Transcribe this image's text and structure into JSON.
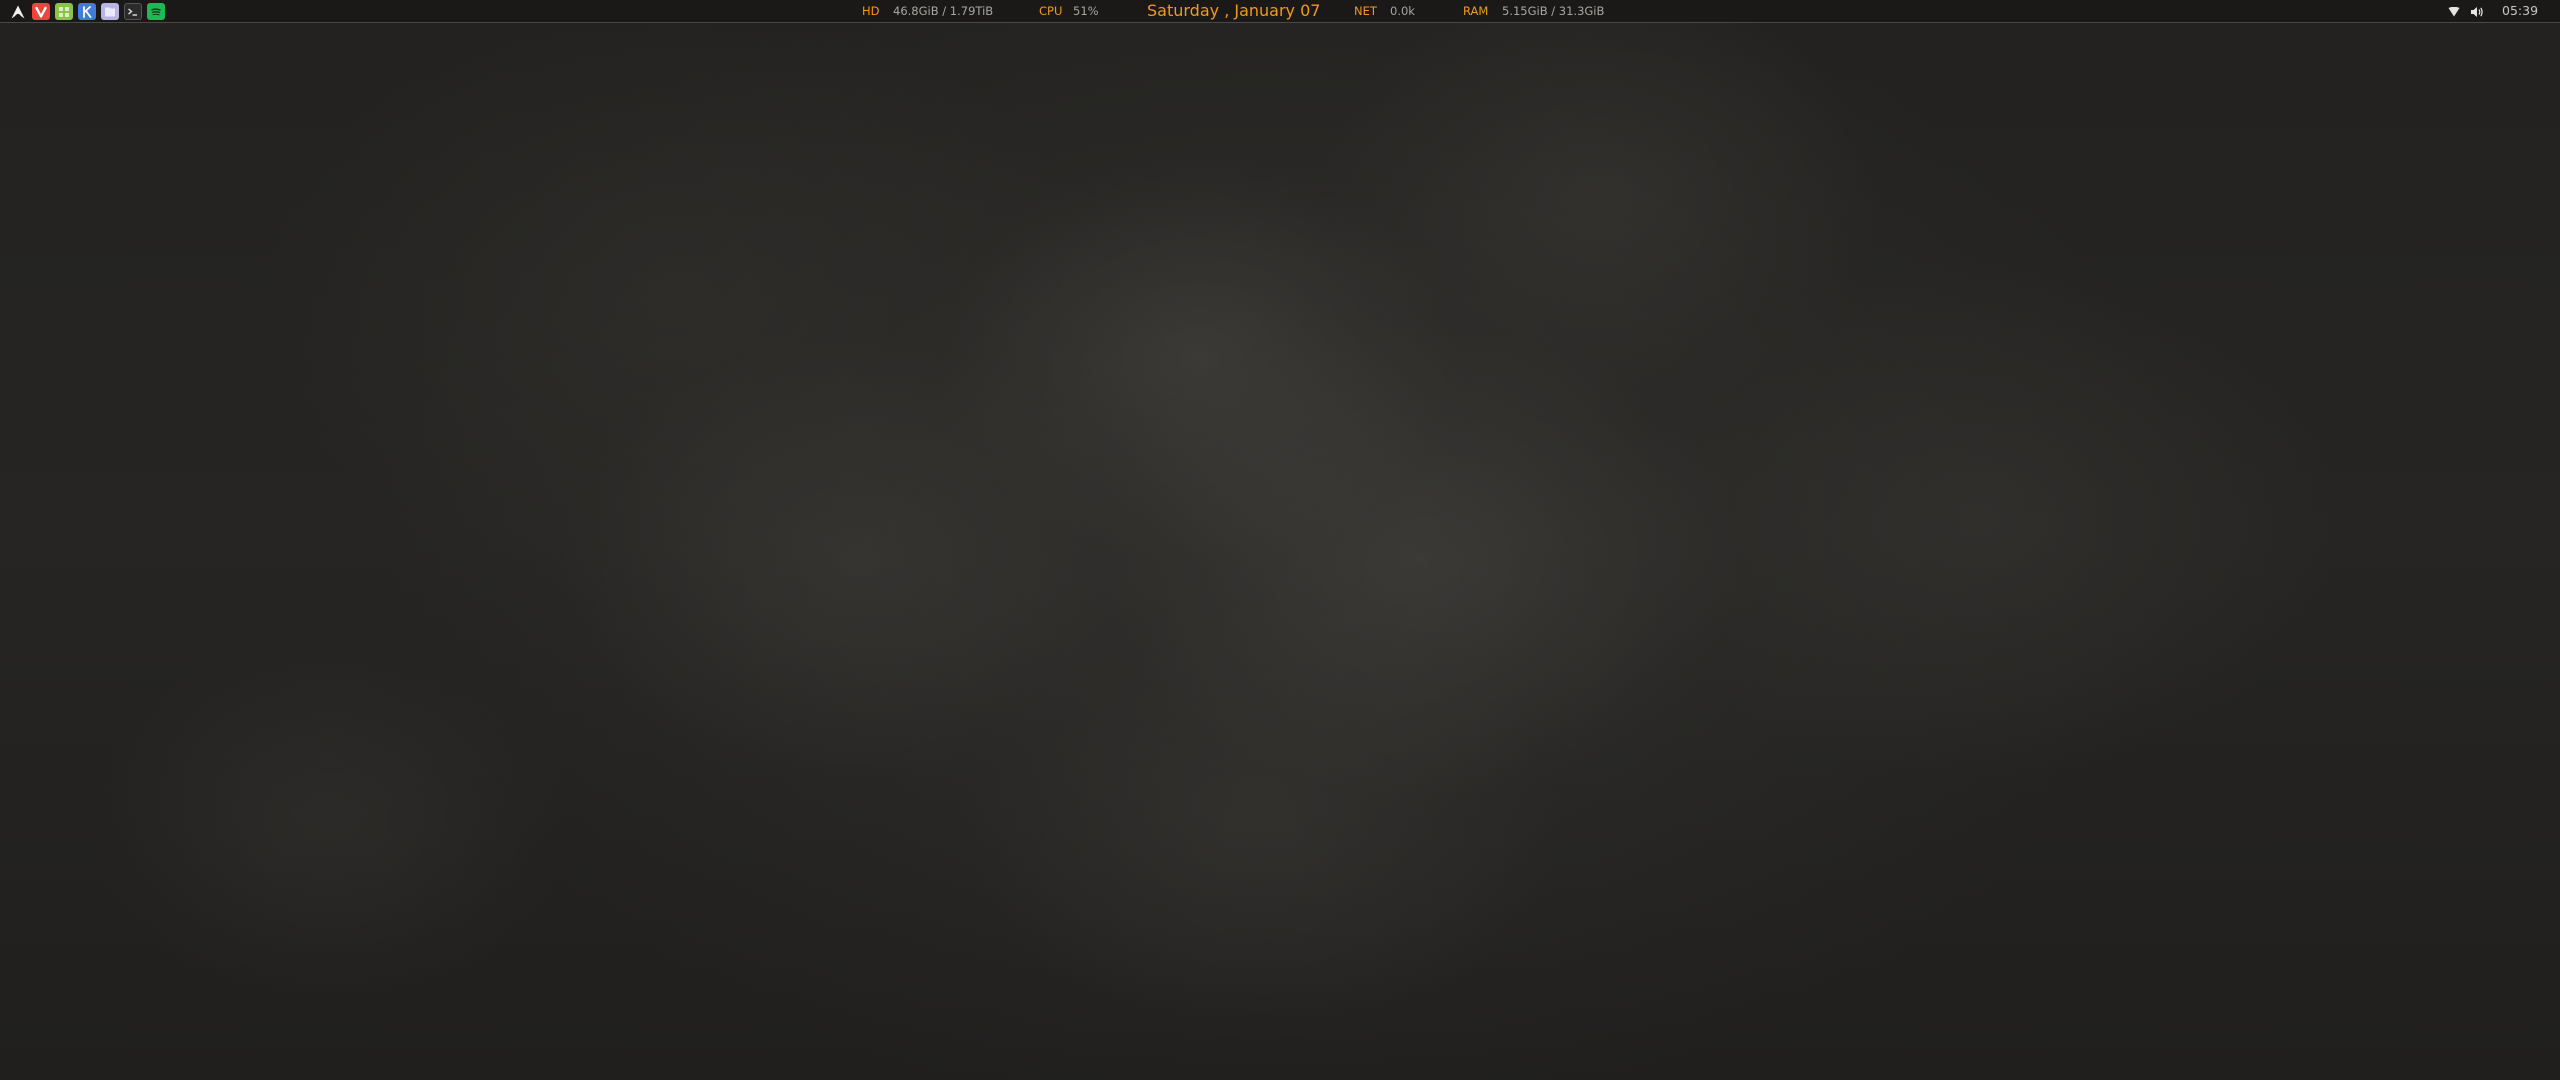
{
  "colors": {
    "accent": "#f29a1a",
    "text": "#a9a6a1",
    "bar_background": "#1a1918",
    "desktop": "#262523"
  },
  "top_bar": {
    "launcher_icon": "arch-linux-icon",
    "apps": [
      {
        "name": "vivaldi-browser-icon",
        "color": "#e8473d"
      },
      {
        "name": "calculator-icon",
        "color": "#8bc34a"
      },
      {
        "name": "krita-app-icon",
        "color": "#3f7ed8"
      },
      {
        "name": "file-manager-icon",
        "color": "#b9b4e6"
      },
      {
        "name": "terminal-icon",
        "color": "#2b2b2b"
      },
      {
        "name": "spotify-icon",
        "color": "#1db954"
      }
    ],
    "stats": {
      "hd": {
        "label": "HD",
        "value": "46.8GiB / 1.79TiB"
      },
      "cpu": {
        "label": "CPU",
        "value": "51%"
      },
      "date": "Saturday , January 07",
      "net": {
        "label": "NET",
        "value": "0.0k"
      },
      "ram": {
        "label": "RAM",
        "value": "5.15GiB / 31.3GiB"
      }
    },
    "tray": {
      "network_icon": "wifi-icon",
      "volume_icon": "volume-icon",
      "time": "05:39"
    }
  }
}
